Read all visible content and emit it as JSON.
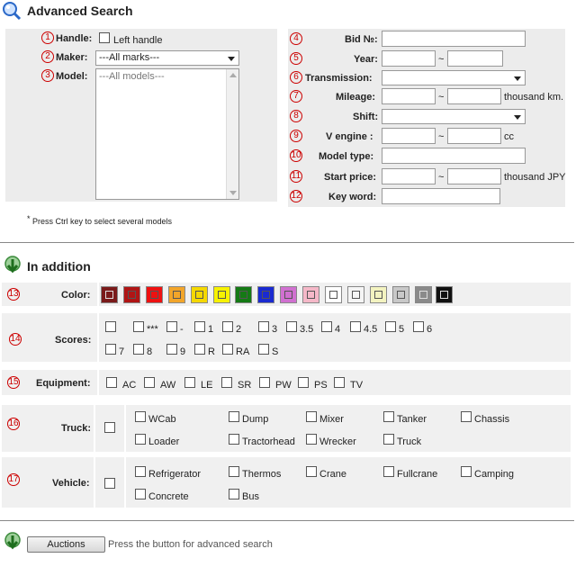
{
  "header": {
    "title": "Advanced Search"
  },
  "left": {
    "handle_label": "Handle:",
    "handle_checkbox_label": "Left handle",
    "maker_label": "Maker:",
    "maker_value": "---All marks---",
    "model_label": "Model:",
    "model_value": "---All models---",
    "note": "Press Ctrl key to select several models"
  },
  "right": {
    "bid_label": "Bid №:",
    "year_label": "Year:",
    "transmission_label": "Transmission:",
    "mileage_label": "Mileage:",
    "mileage_unit": "thousand km.",
    "shift_label": "Shift:",
    "vengine_label": "V engine :",
    "vengine_unit": "cc",
    "modeltype_label": "Model type:",
    "startprice_label": "Start price:",
    "startprice_unit": "thousand JPY",
    "keyword_label": "Key word:",
    "tilde": "~"
  },
  "numbers": [
    "1",
    "2",
    "3",
    "4",
    "5",
    "6",
    "7",
    "8",
    "9",
    "10",
    "11",
    "12",
    "13",
    "14",
    "15",
    "16",
    "17"
  ],
  "addition": {
    "title": "In addition",
    "color_label": "Color:",
    "colors": [
      "#7a1a1a",
      "#b01515",
      "#ee1111",
      "#f2a52a",
      "#f5d800",
      "#f7f200",
      "#157a15",
      "#1a2ad0",
      "#d070d0",
      "#f5b8c8",
      "#ffffff",
      "#f5f5f5",
      "#f3f3c0",
      "#c8c8c8",
      "#8a8a8a",
      "#111111"
    ],
    "scores_label": "Scores:",
    "scores": [
      "***",
      "-",
      "1",
      "2",
      "3",
      "3.5",
      "4",
      "4.5",
      "5",
      "6",
      "7",
      "8",
      "9",
      "R",
      "RA",
      "S"
    ],
    "equipment_label": "Equipment:",
    "equipment": [
      "AC",
      "AW",
      "LE",
      "SR",
      "PW",
      "PS",
      "TV"
    ],
    "truck_label": "Truck:",
    "truck": [
      "WCab",
      "Dump",
      "Mixer",
      "Tanker",
      "Chassis",
      "Loader",
      "Tractorhead",
      "Wrecker",
      "Truck"
    ],
    "vehicle_label": "Vehicle:",
    "vehicle": [
      "Refrigerator",
      "Thermos",
      "Crane",
      "Fullcrane",
      "Camping",
      "Concrete",
      "Bus"
    ]
  },
  "footer": {
    "button_label": "Auctions",
    "hint": "Press the button for advanced search"
  }
}
